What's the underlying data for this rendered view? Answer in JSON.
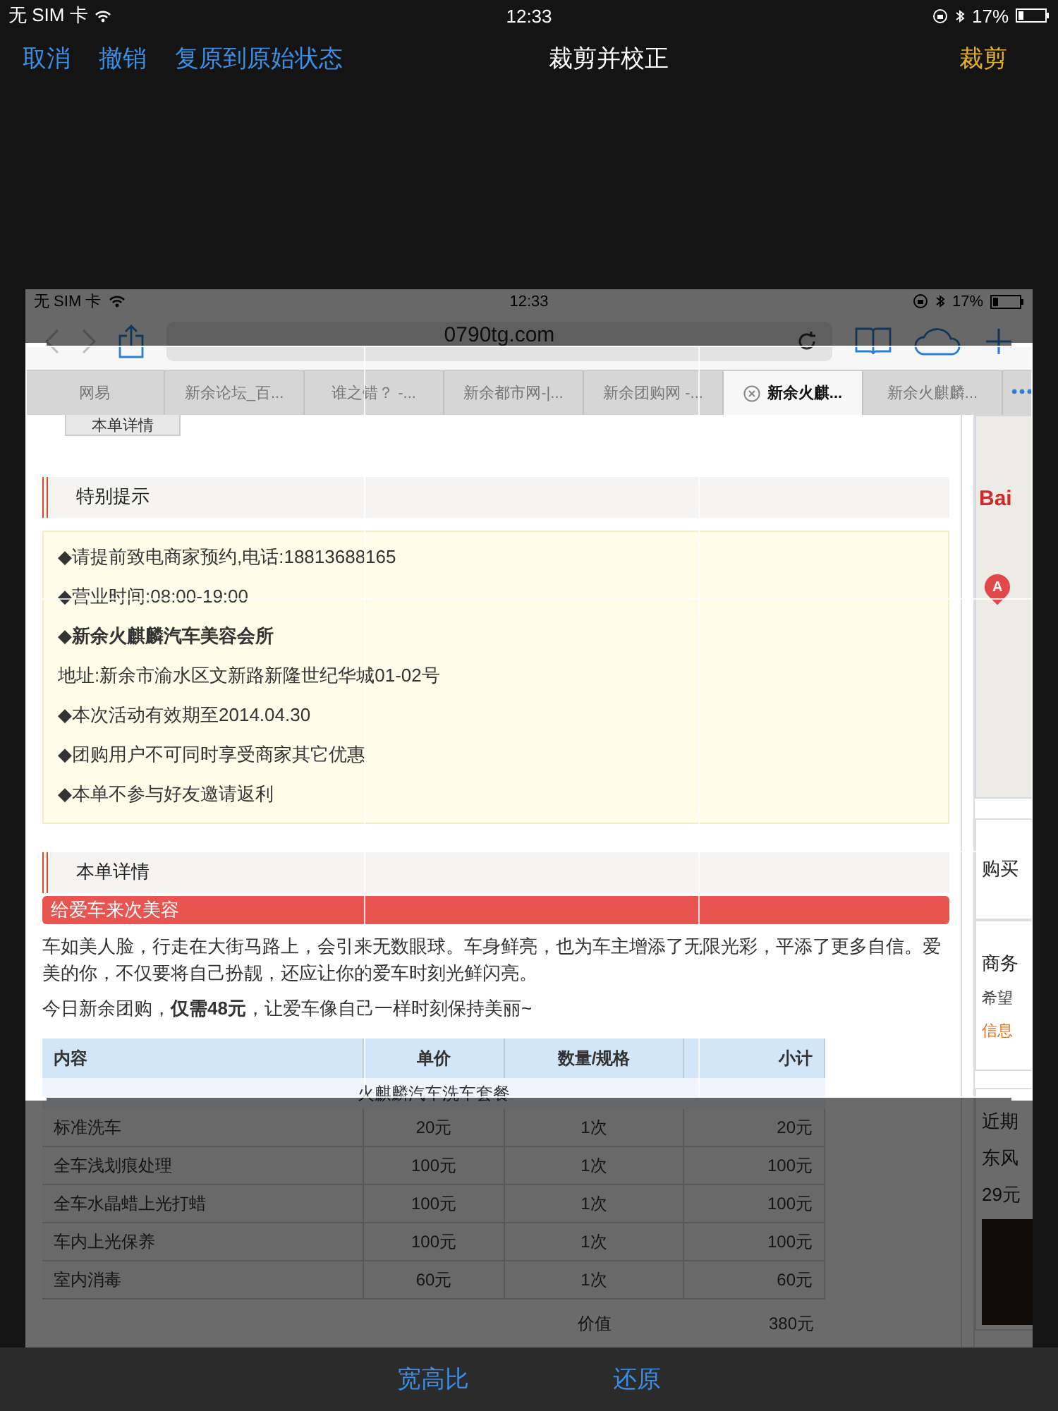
{
  "status_bar": {
    "carrier": "无 SIM 卡",
    "time": "12:33",
    "battery": "17%"
  },
  "nav": {
    "buttons": [
      "取消",
      "撤销",
      "复原到原始状态"
    ],
    "title": "裁剪并校正",
    "confirm": "裁剪"
  },
  "screenshot": {
    "status_bar": {
      "carrier": "无 SIM 卡",
      "time": "12:33",
      "battery": "17%"
    },
    "url": "0790tg.com",
    "tabs": [
      {
        "label": "网易",
        "selected": false
      },
      {
        "label": "新余论坛_百...",
        "selected": false
      },
      {
        "label": "谁之错？ -...",
        "selected": false
      },
      {
        "label": "新余都市网-|...",
        "selected": false
      },
      {
        "label": "新余团购网 -...",
        "selected": false
      },
      {
        "label": "新余火麒...",
        "selected": true
      },
      {
        "label": "新余火麒麟...",
        "selected": false
      }
    ],
    "partial_tab": "本单详情",
    "notice": {
      "title": "特别提示",
      "lines": [
        {
          "text": "◆请提前致电商家预约,电话:18813688165",
          "bold": false
        },
        {
          "text": "◆营业时间:08:00-19:00",
          "bold": false
        },
        {
          "text": "◆新余火麒麟汽车美容会所",
          "bold": true
        },
        {
          "text": "地址:新余市渝水区文新路新隆世纪华城01-02号",
          "bold": false
        },
        {
          "text": "◆本次活动有效期至2014.04.30",
          "bold": false
        },
        {
          "text": "◆团购用户不可同时享受商家其它优惠",
          "bold": false
        },
        {
          "text": "◆本单不参与好友邀请返利",
          "bold": false
        }
      ]
    },
    "details": {
      "title": "本单详情",
      "banner": "给爱车来次美容",
      "paragraphs": [
        "车如美人脸，行走在大街马路上，会引来无数眼球。车身鲜亮，也为车主增添了无限光彩，平添了更多自信。爱美的你，不仅要将自己扮靓，还应让你的爱车时刻光鲜闪亮。",
        "今日新余团购，**仅需48元**，让爱车像自己一样时刻保持美丽~"
      ],
      "table": {
        "columns": [
          "内容",
          "单价",
          "数量/规格",
          "小计"
        ],
        "group": "火麒麟汽车洗车套餐",
        "rows": [
          [
            "标准洗车",
            "20元",
            "1次",
            "20元"
          ],
          [
            "全车浅划痕处理",
            "100元",
            "1次",
            "100元"
          ],
          [
            "全车水晶蜡上光打蜡",
            "100元",
            "1次",
            "100元"
          ],
          [
            "车内上光保养",
            "100元",
            "1次",
            "100元"
          ],
          [
            "室内消毒",
            "60元",
            "1次",
            "60元"
          ]
        ],
        "total": {
          "label": "价值",
          "value": "380元"
        }
      }
    },
    "sidebar": {
      "map_logo": "Bai",
      "marker": "A",
      "buy": "购买",
      "business": "商务",
      "business_text": "希望",
      "business_link": "信息",
      "recent": "近期",
      "recent_item": "东风",
      "recent_price": "29元"
    }
  },
  "toolbar": {
    "buttons": [
      "宽高比",
      "还原"
    ]
  }
}
